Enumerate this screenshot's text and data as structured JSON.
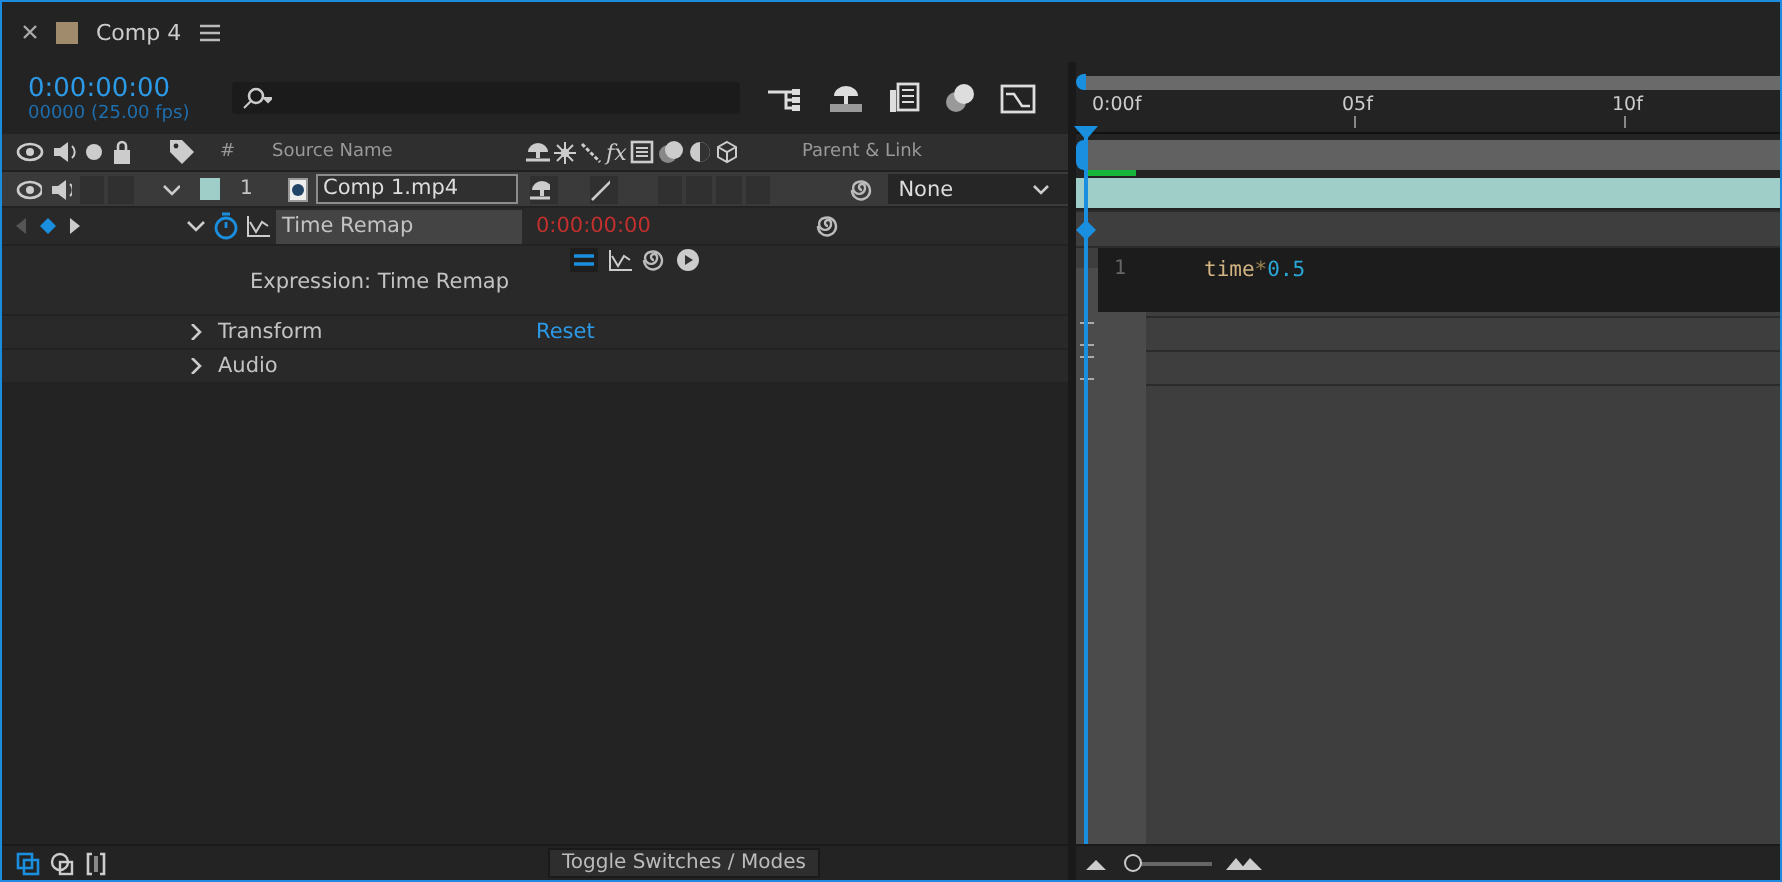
{
  "tab": {
    "title": "Comp 4",
    "color": "#a08c6c"
  },
  "timecode": "0:00:00:00",
  "frame_rate": "00000 (25.00 fps)",
  "columns": [
    {
      "label": "#"
    },
    {
      "label": "Source Name"
    },
    {
      "label": "Parent & Link"
    }
  ],
  "effects_label": "fx",
  "layer": {
    "number": "1",
    "name": "Comp 1.mp4",
    "parent": "None",
    "color": "#9fcdc7",
    "expanded": true,
    "solo": false,
    "locked": false,
    "shy": true,
    "quality": true,
    "property": {
      "name": "Time Remap",
      "value": "0:00:00:00",
      "expanded": true,
      "expression_label": "Expression: Time Remap"
    },
    "groups": [
      {
        "name": "Transform",
        "action": "Reset",
        "expanded": false
      },
      {
        "name": "Audio",
        "expanded": false
      }
    ]
  },
  "ruler": [
    "0:00f",
    "05f",
    "10f"
  ],
  "expression": {
    "line_number": "1",
    "tokens": [
      {
        "text": "time",
        "kind": "keyword"
      },
      {
        "text": "*",
        "kind": "operator"
      },
      {
        "text": "0.5",
        "kind": "number"
      }
    ]
  },
  "toggle_button": "Toggle Switches / Modes",
  "zoom": {
    "level": 0.05
  }
}
